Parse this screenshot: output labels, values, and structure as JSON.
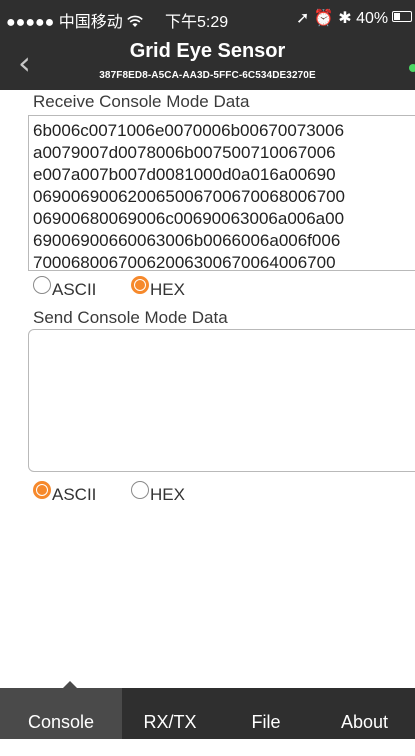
{
  "status_bar": {
    "carrier": "●●●●● 中国移动",
    "time": "下午5:29",
    "indicators": "➚ ⏰ ✱ 40%",
    "wifi_icon": "wifi-icon",
    "battery_level": 0.4
  },
  "nav": {
    "back_icon": "chevron-left-icon",
    "back_glyph": "‹",
    "title": "Grid Eye Sensor",
    "subtitle": "387F8ED8-A5CA-AA3D-5FFC-6C534DE3270E",
    "status_dot_color": "#4cd964"
  },
  "receive": {
    "label": "Receive Console Mode Data",
    "lines": [
      "6b006c0071006e0070006b00670073006",
      "a0079007d0078006b007500710067006",
      "e007a007b007d0081000d0a016a00690",
      "069006900620065006700670068006700",
      "06900680069006c00690063006a006a00",
      "69006900660063006b0066006a006f006",
      "70006800670062006300670064006700"
    ],
    "mode_options": [
      {
        "label": "ASCII",
        "selected": false
      },
      {
        "label": "HEX",
        "selected": true
      }
    ]
  },
  "send": {
    "label": "Send Console Mode Data",
    "value": "",
    "mode_options": [
      {
        "label": "ASCII",
        "selected": true
      },
      {
        "label": "HEX",
        "selected": false
      }
    ]
  },
  "tabs": [
    {
      "label": "Console",
      "active": true
    },
    {
      "label": "RX/TX",
      "active": false
    },
    {
      "label": "File",
      "active": false
    },
    {
      "label": "About",
      "active": false
    }
  ],
  "colors": {
    "bar_background": "#2f2f2f",
    "active_tab": "#4a4a4a",
    "accent": "#f6892c"
  }
}
